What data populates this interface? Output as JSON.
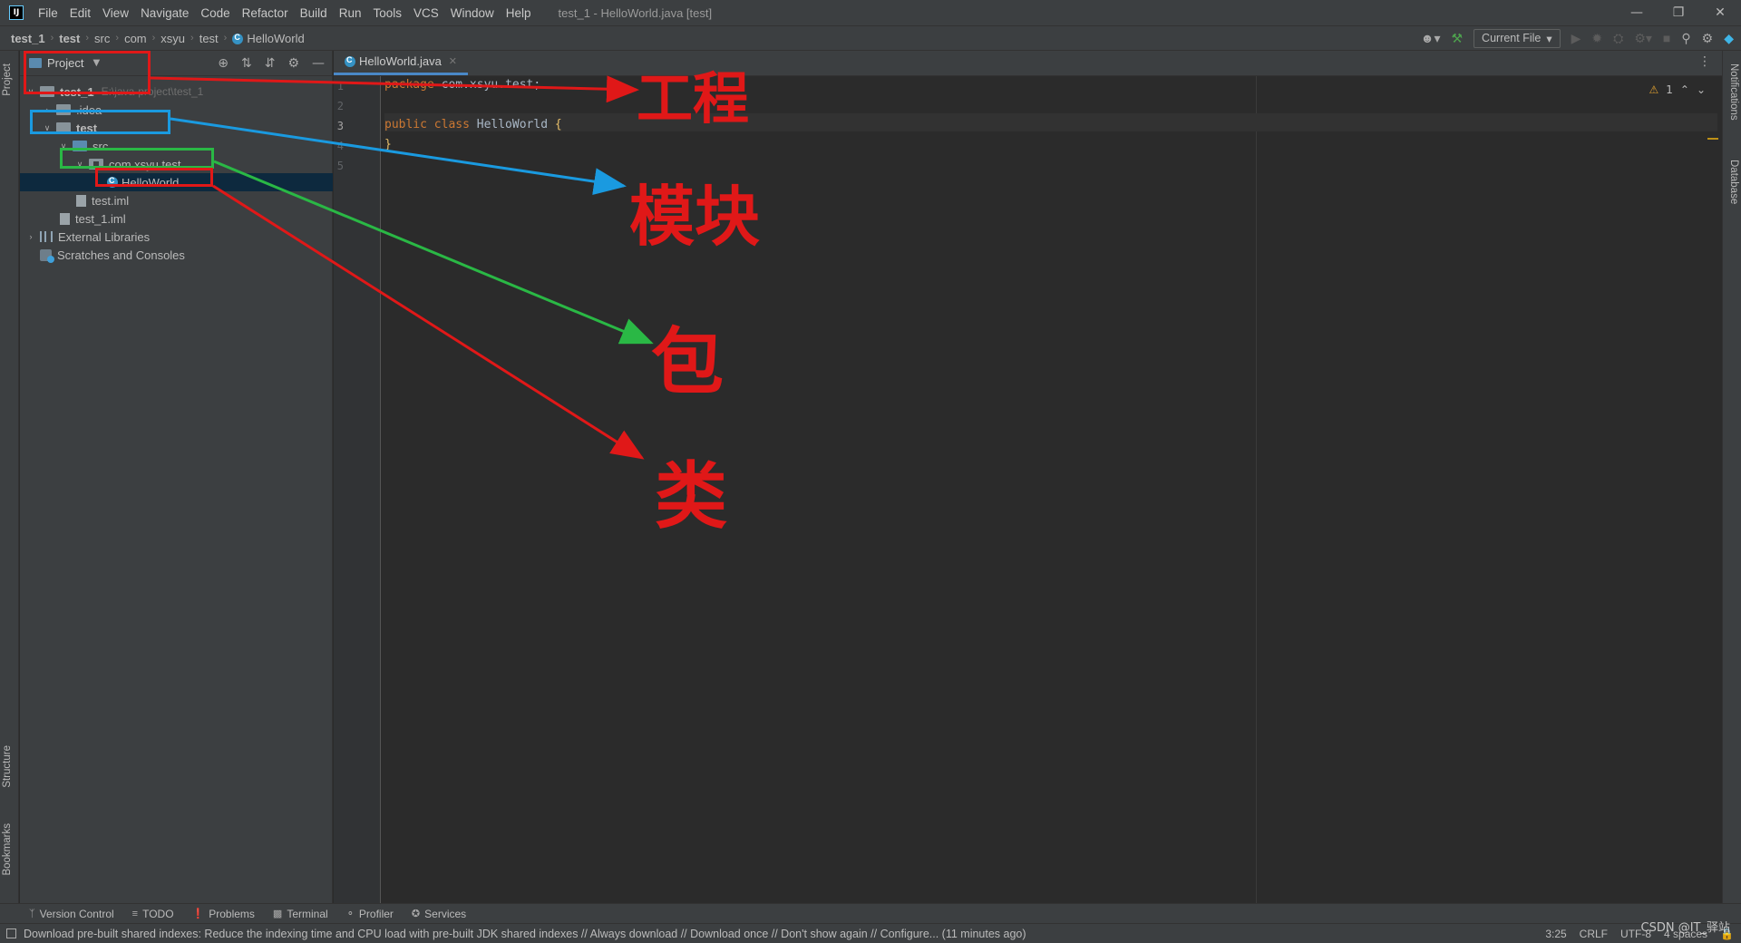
{
  "titlebar": {
    "menu": [
      "File",
      "Edit",
      "View",
      "Navigate",
      "Code",
      "Refactor",
      "Build",
      "Run",
      "Tools",
      "VCS",
      "Window",
      "Help"
    ],
    "title": "test_1 - HelloWorld.java [test]"
  },
  "breadcrumb": {
    "items": [
      "test_1",
      "test",
      "src",
      "com",
      "xsyu",
      "test",
      "HelloWorld"
    ]
  },
  "toolbar": {
    "run_config": "Current File"
  },
  "project_panel": {
    "title": "Project",
    "tree": [
      {
        "label": "test_1",
        "hint": "E:\\java-project\\test_1"
      },
      {
        "label": ".idea"
      },
      {
        "label": "test"
      },
      {
        "label": "src"
      },
      {
        "label": "com.xsyu.test"
      },
      {
        "label": "HelloWorld"
      },
      {
        "label": "test.iml"
      },
      {
        "label": "test_1.iml"
      },
      {
        "label": "External Libraries"
      },
      {
        "label": "Scratches and Consoles"
      }
    ]
  },
  "editor": {
    "tab": "HelloWorld.java",
    "line_numbers": [
      "1",
      "2",
      "3",
      "4",
      "5"
    ],
    "code": {
      "l1_kw": "package",
      "l1_rest": " com.xsyu.test;",
      "l3_kw": "public class",
      "l3_name": " HelloWorld",
      "l3_brace": " {",
      "l4_brace": "}"
    },
    "warnings": "1"
  },
  "side_tabs": {
    "left": [
      "Project",
      "Structure",
      "Bookmarks"
    ],
    "right": [
      "Notifications",
      "Database"
    ]
  },
  "tool_tabs": [
    "Version Control",
    "TODO",
    "Problems",
    "Terminal",
    "Profiler",
    "Services"
  ],
  "statusbar": {
    "message": "Download pre-built shared indexes: Reduce the indexing time and CPU load with pre-built JDK shared indexes // Always download // Download once // Don't show again // Configure... (11 minutes ago)",
    "position": "3:25",
    "line_sep": "CRLF",
    "encoding": "UTF-8",
    "indent": "4 spaces"
  },
  "watermark": "CSDN @IT_驿站",
  "annotations": {
    "project_label": "工程",
    "module_label": "模块",
    "package_label": "包",
    "class_label": "类",
    "colors": {
      "red": "#e01818",
      "blue": "#1a9ae0",
      "green": "#2ab845"
    }
  }
}
